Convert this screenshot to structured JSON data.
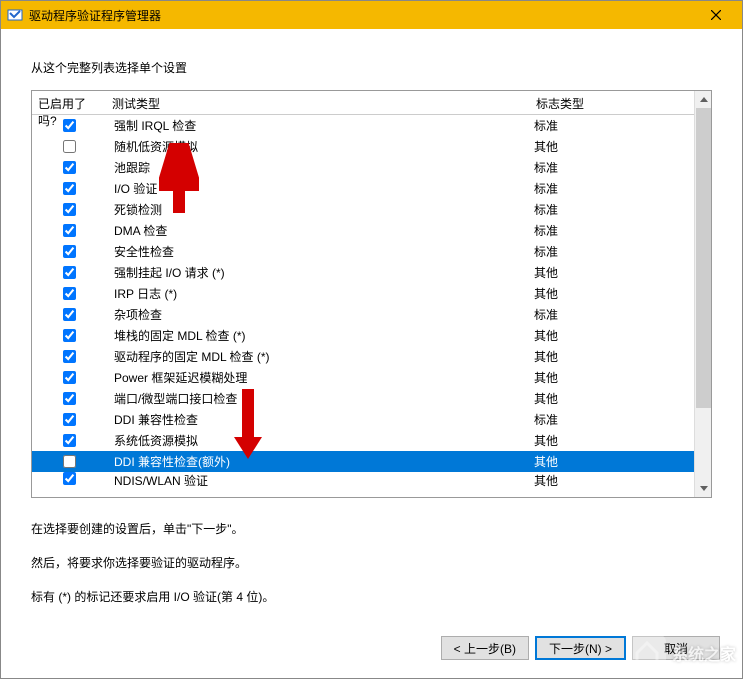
{
  "titlebar": {
    "title": "驱动程序验证程序管理器"
  },
  "instruction": "从这个完整列表选择单个设置",
  "columns": {
    "enabled": "已启用了吗?",
    "test": "测试类型",
    "flag": "标志类型"
  },
  "rows": [
    {
      "enabled": true,
      "test": "强制 IRQL 检查",
      "flag": "标准"
    },
    {
      "enabled": false,
      "test": "随机低资源模拟",
      "flag": "其他"
    },
    {
      "enabled": true,
      "test": "池跟踪",
      "flag": "标准"
    },
    {
      "enabled": true,
      "test": "I/O 验证",
      "flag": "标准"
    },
    {
      "enabled": true,
      "test": "死锁检测",
      "flag": "标准"
    },
    {
      "enabled": true,
      "test": "DMA 检查",
      "flag": "标准"
    },
    {
      "enabled": true,
      "test": "安全性检查",
      "flag": "标准"
    },
    {
      "enabled": true,
      "test": "强制挂起 I/O 请求 (*)",
      "flag": "其他"
    },
    {
      "enabled": true,
      "test": "IRP 日志 (*)",
      "flag": "其他"
    },
    {
      "enabled": true,
      "test": "杂项检查",
      "flag": "标准"
    },
    {
      "enabled": true,
      "test": "堆栈的固定 MDL 检查 (*)",
      "flag": "其他"
    },
    {
      "enabled": true,
      "test": "驱动程序的固定 MDL 检查 (*)",
      "flag": "其他"
    },
    {
      "enabled": true,
      "test": "Power 框架延迟模糊处理",
      "flag": "其他"
    },
    {
      "enabled": true,
      "test": "端口/微型端口接口检查",
      "flag": "其他"
    },
    {
      "enabled": true,
      "test": "DDI 兼容性检查",
      "flag": "标准"
    },
    {
      "enabled": true,
      "test": "系统低资源模拟",
      "flag": "其他"
    },
    {
      "enabled": false,
      "test": "DDI 兼容性检查(额外)",
      "flag": "其他",
      "selected": true
    },
    {
      "enabled": true,
      "test": "NDIS/WLAN 验证",
      "flag": "其他",
      "lastrow": true
    }
  ],
  "help": {
    "line1": "在选择要创建的设置后，单击\"下一步\"。",
    "line2": "然后，将要求你选择要验证的驱动程序。",
    "line3": "标有 (*) 的标记还要求启用 I/O 验证(第 4 位)。"
  },
  "buttons": {
    "back": "< 上一步(B)",
    "next": "下一步(N) >",
    "cancel": "取消"
  },
  "watermark": "系统之家"
}
